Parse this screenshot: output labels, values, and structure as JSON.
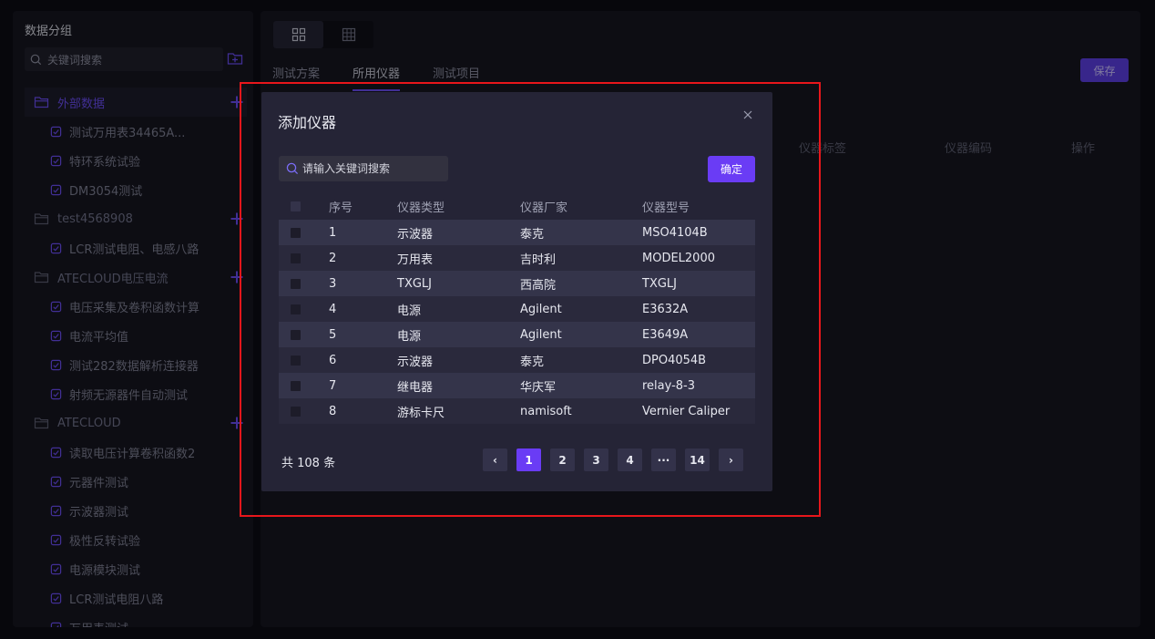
{
  "sidebar": {
    "title": "数据分组",
    "search_placeholder": "关键词搜索",
    "groups": [
      {
        "label": "外部数据",
        "active": true,
        "items": [
          "测试万用表34465A...",
          "特环系统试验",
          "DM3054测试"
        ]
      },
      {
        "label": "test4568908",
        "active": false,
        "items": [
          "LCR测试电阻、电感八路"
        ]
      },
      {
        "label": "ATECLOUD电压电流",
        "active": false,
        "items": [
          "电压采集及卷积函数计算",
          "电流平均值",
          "测试282数据解析连接器",
          "射频无源器件自动测试"
        ]
      },
      {
        "label": "ATECLOUD",
        "active": false,
        "items": [
          "读取电压计算卷积函数2",
          "元器件测试",
          "示波器测试",
          "极性反转试验",
          "电源模块测试",
          "LCR测试电阻八路",
          "万用表测试"
        ]
      }
    ]
  },
  "main": {
    "tabs": [
      "测试方案",
      "所用仪器",
      "测试项目"
    ],
    "active_tab": 1,
    "save_label": "保存",
    "bg_columns": [
      "仪器标签",
      "仪器编码",
      "操作"
    ]
  },
  "modal": {
    "title": "添加仪器",
    "search_placeholder": "请输入关键词搜索",
    "confirm_label": "确定",
    "columns": [
      "序号",
      "仪器类型",
      "仪器厂家",
      "仪器型号"
    ],
    "rows": [
      [
        "1",
        "示波器",
        "泰克",
        "MSO4104B"
      ],
      [
        "2",
        "万用表",
        "吉时利",
        "MODEL2000"
      ],
      [
        "3",
        "TXGLJ",
        "西高院",
        "TXGLJ"
      ],
      [
        "4",
        "电源",
        "Agilent",
        "E3632A"
      ],
      [
        "5",
        "电源",
        "Agilent",
        "E3649A"
      ],
      [
        "6",
        "示波器",
        "泰克",
        "DPO4054B"
      ],
      [
        "7",
        "继电器",
        "华庆军",
        "relay-8-3"
      ],
      [
        "8",
        "游标卡尺",
        "namisoft",
        "Vernier Caliper"
      ]
    ],
    "total_text": "共 108 条",
    "pagination": {
      "prev": "‹",
      "next": "›",
      "pages": [
        "1",
        "2",
        "3",
        "4",
        "···",
        "14"
      ],
      "current": "1"
    }
  },
  "colors": {
    "accent": "#6a3cf5",
    "highlight": "#e8161b",
    "panel": "#15151f",
    "modal": "#252436"
  },
  "icons": [
    "search-icon",
    "folder-add-icon",
    "folder-icon",
    "file-check-icon",
    "plus-icon",
    "grid-view-icon",
    "table-view-icon",
    "close-icon"
  ]
}
